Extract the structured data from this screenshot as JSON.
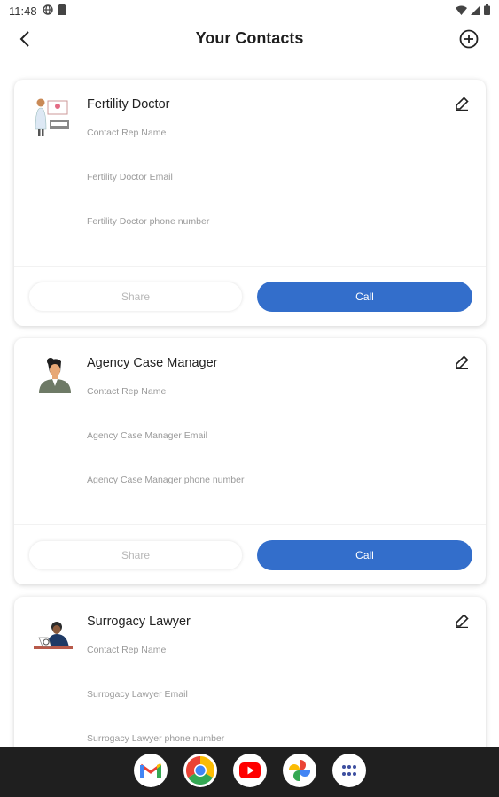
{
  "status_bar": {
    "time": "11:48"
  },
  "header": {
    "title": "Your Contacts"
  },
  "contacts": [
    {
      "title": "Fertility Doctor",
      "rep_name": "Contact Rep Name",
      "email": "Fertility Doctor Email",
      "phone": "Fertility Doctor phone number",
      "share_label": "Share",
      "call_label": "Call"
    },
    {
      "title": "Agency Case Manager",
      "rep_name": "Contact Rep Name",
      "email": "Agency Case Manager Email",
      "phone": "Agency Case Manager phone number",
      "share_label": "Share",
      "call_label": "Call"
    },
    {
      "title": "Surrogacy Lawyer",
      "rep_name": "Contact Rep Name",
      "email": "Surrogacy Lawyer Email",
      "phone": "Surrogacy Lawyer phone number"
    }
  ],
  "dock": {
    "apps": [
      "gmail-icon",
      "chrome-icon",
      "youtube-icon",
      "google-photos-icon",
      "app-drawer-icon"
    ]
  },
  "colors": {
    "accent": "#336ecb",
    "nav_bg": "#1f1f1f"
  }
}
